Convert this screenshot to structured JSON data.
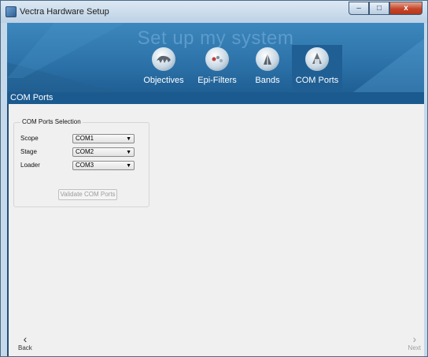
{
  "window": {
    "title": "Vectra Hardware Setup",
    "min": "–",
    "max": "□",
    "close": "x"
  },
  "header": {
    "title": "Set up my system"
  },
  "tabs": [
    {
      "label": "Objectives",
      "icon": "objectives-icon"
    },
    {
      "label": "Epi-Filters",
      "icon": "epi-filters-icon"
    },
    {
      "label": "Bands",
      "icon": "bands-icon"
    },
    {
      "label": "COM Ports",
      "icon": "com-ports-icon",
      "active": true
    }
  ],
  "section": {
    "title": "COM Ports"
  },
  "com_ports": {
    "group_title": "COM Ports Selection",
    "rows": [
      {
        "label": "Scope",
        "value": "COM1"
      },
      {
        "label": "Stage",
        "value": "COM2"
      },
      {
        "label": "Loader",
        "value": "COM3"
      }
    ],
    "validate_label": "Validate COM Ports"
  },
  "footer": {
    "back_label": "Back",
    "back_icon": "‹",
    "next_label": "Next",
    "next_icon": "›"
  },
  "colors": {
    "header": "#2c72a8",
    "section_bar": "#1b5a8f",
    "content_bg": "#f0f0f0"
  }
}
